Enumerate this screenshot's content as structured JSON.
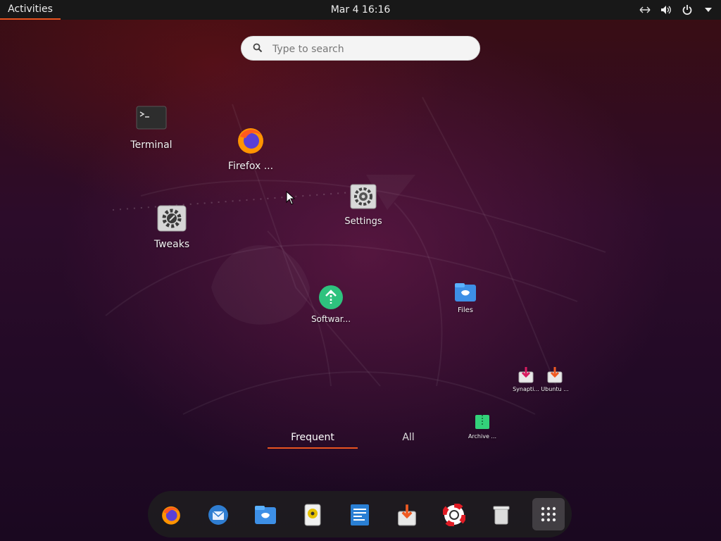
{
  "topbar": {
    "activities_label": "Activities",
    "clock": "Mar 4  16:16",
    "icons": [
      "network-icon",
      "volume-icon",
      "power-icon",
      "chevron-down-icon"
    ]
  },
  "search": {
    "placeholder": "Type to search"
  },
  "apps": {
    "terminal": "Terminal",
    "firefox": "Firefox ...",
    "settings": "Settings",
    "tweaks": "Tweaks",
    "software": "Softwar...",
    "files": "Files",
    "synaptic": "Synapti...",
    "ubuntu": "Ubuntu ...",
    "archive": "Archive ..."
  },
  "tabs": {
    "frequent": "Frequent",
    "all": "All",
    "active": "frequent"
  },
  "dock": {
    "items": [
      "firefox-icon",
      "thunderbird-icon",
      "files-icon",
      "rhythmbox-icon",
      "libreoffice-writer-icon",
      "software-install-icon",
      "help-icon",
      "trash-icon",
      "show-applications-icon"
    ]
  },
  "colors": {
    "accent": "#e95420",
    "topbar": "#181818"
  }
}
